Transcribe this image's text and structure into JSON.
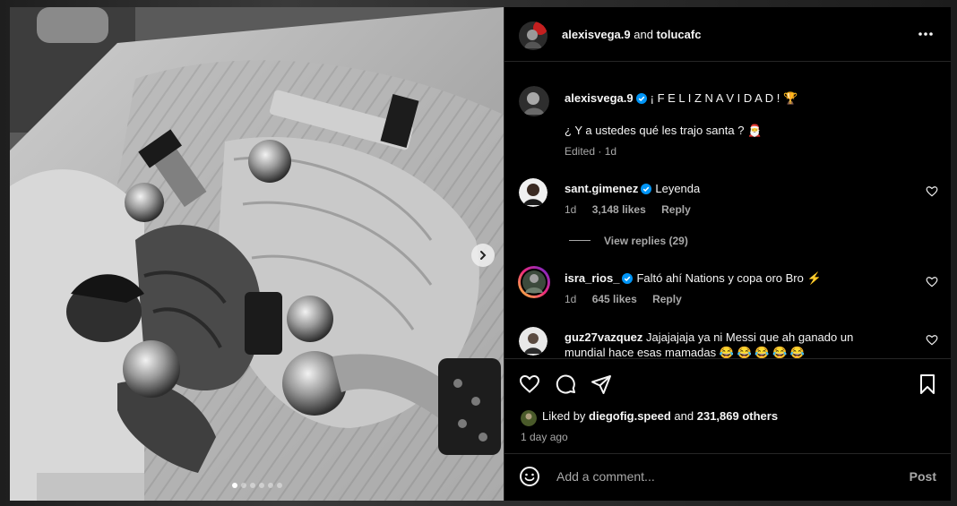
{
  "header": {
    "author": "alexisvega.9",
    "and": "and",
    "coauthor": "tolucafc"
  },
  "caption": {
    "username": "alexisvega.9",
    "line1": "¡ F E L I Z N A V I D A D ! 🏆",
    "line2": "¿ Y a ustedes qué les trajo santa ? 🎅",
    "edited": "Edited · 1d"
  },
  "comments": [
    {
      "username": "sant.gimenez",
      "text": "Leyenda",
      "time": "1d",
      "likes": "3,148 likes",
      "reply": "Reply"
    },
    {
      "username": "isra_rios_",
      "text": "Faltó ahí Nations y copa oro Bro ⚡",
      "time": "1d",
      "likes": "645 likes",
      "reply": "Reply"
    },
    {
      "username": "guz27vazquez",
      "text": "Jajajajaja ya ni Messi que ah ganado un mundial hace esas mamadas 😂 😂 😂 😂 😂"
    }
  ],
  "view_replies": "View replies (29)",
  "liked_by": {
    "prefix": "Liked by",
    "user": "diegofig.speed",
    "and": "and",
    "others": "231,869 others"
  },
  "time_ago": "1 day ago",
  "add_comment": {
    "placeholder": "Add a comment...",
    "post_label": "Post"
  },
  "carousel": {
    "count": 6,
    "active": 0
  },
  "colors": {
    "verified": "#0095f6",
    "muted": "#a8a8a8",
    "background": "#000000"
  },
  "icons": [
    "more-icon",
    "heart-icon",
    "comment-icon",
    "share-icon",
    "bookmark-icon",
    "emoji-icon",
    "next-arrow-icon",
    "verified-icon"
  ]
}
